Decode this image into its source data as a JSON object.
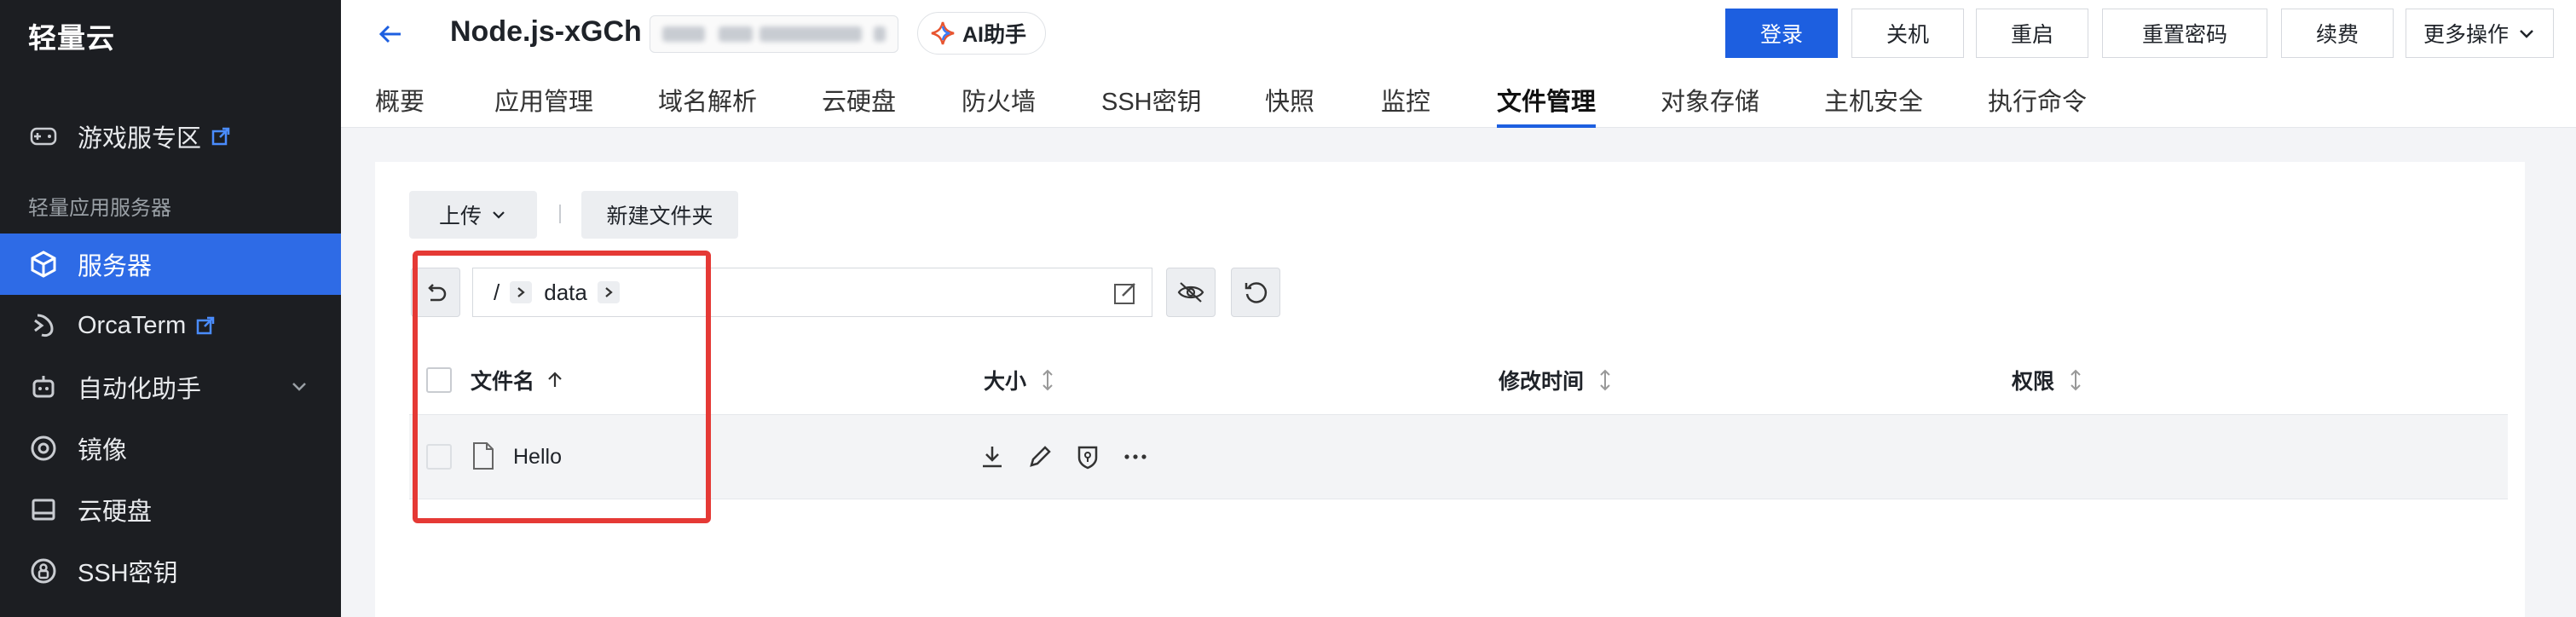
{
  "brand": "轻量云",
  "sidebar": {
    "section_label": "轻量应用服务器",
    "items": [
      {
        "label": "游戏服专区",
        "icon": "gamepad-icon",
        "external": true
      },
      {
        "label": "服务器",
        "icon": "cube-icon",
        "active": true
      },
      {
        "label": "OrcaTerm",
        "icon": "terminal-icon",
        "external": true
      },
      {
        "label": "自动化助手",
        "icon": "robot-icon",
        "expandable": true
      },
      {
        "label": "镜像",
        "icon": "image-disc-icon"
      },
      {
        "label": "云硬盘",
        "icon": "disk-icon"
      },
      {
        "label": "SSH密钥",
        "icon": "key-icon"
      }
    ]
  },
  "header": {
    "instance_name": "Node.js-xGCh",
    "ai_label": "AI助手",
    "buttons": {
      "login": "登录",
      "shutdown": "关机",
      "restart": "重启",
      "reset_password": "重置密码",
      "renew": "续费",
      "more": "更多操作"
    },
    "tabs": [
      "概要",
      "应用管理",
      "域名解析",
      "云硬盘",
      "防火墙",
      "SSH密钥",
      "快照",
      "监控",
      "文件管理",
      "对象存储",
      "主机安全",
      "执行命令"
    ],
    "active_tab": "文件管理"
  },
  "toolbar": {
    "upload": "上传",
    "new_folder": "新建文件夹"
  },
  "path": {
    "root": "/",
    "segment": "data"
  },
  "table": {
    "columns": {
      "name": "文件名",
      "size": "大小",
      "modified": "修改时间",
      "permission": "权限"
    },
    "rows": [
      {
        "name": "Hello",
        "size": "",
        "modified": "",
        "permission": ""
      }
    ]
  },
  "colors": {
    "primary": "#1d5fe0",
    "sidebar_bg": "#1c1e22",
    "highlight": "#e53935"
  }
}
